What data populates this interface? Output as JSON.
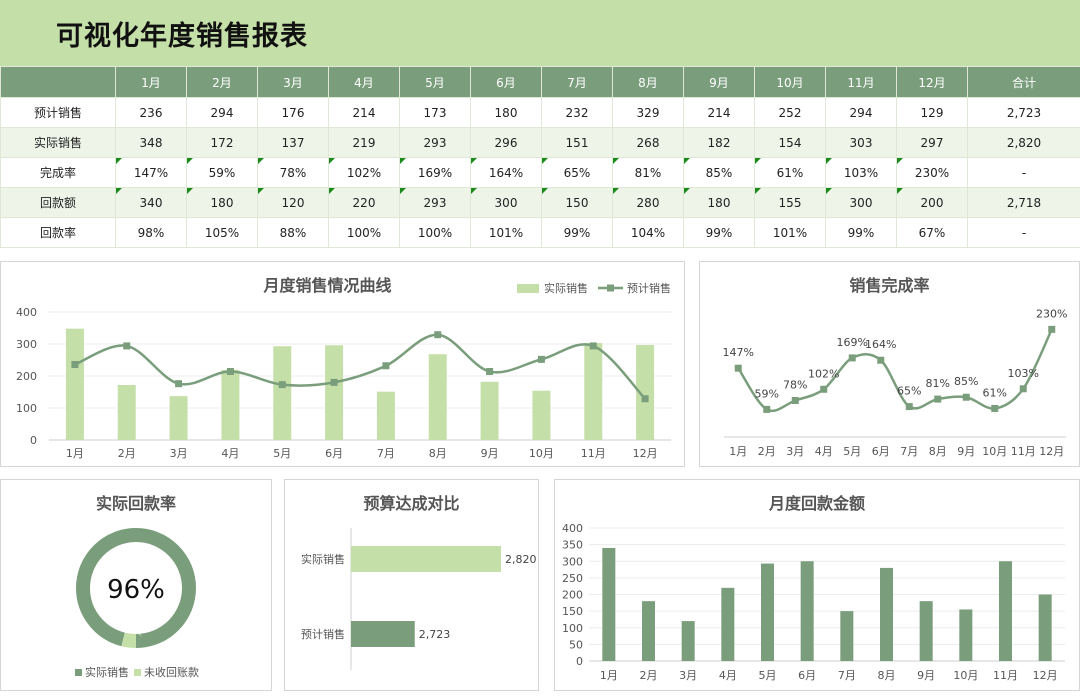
{
  "title": "可视化年度销售报表",
  "table": {
    "columns": [
      "",
      "1月",
      "2月",
      "3月",
      "4月",
      "5月",
      "6月",
      "7月",
      "8月",
      "9月",
      "10月",
      "11月",
      "12月",
      "合计"
    ],
    "rows": [
      {
        "label": "预计销售",
        "values": [
          "236",
          "294",
          "176",
          "214",
          "173",
          "180",
          "232",
          "329",
          "214",
          "252",
          "294",
          "129",
          "2,723"
        ],
        "flags": false
      },
      {
        "label": "实际销售",
        "values": [
          "348",
          "172",
          "137",
          "219",
          "293",
          "296",
          "151",
          "268",
          "182",
          "154",
          "303",
          "297",
          "2,820"
        ],
        "flags": false
      },
      {
        "label": "完成率",
        "values": [
          "147%",
          "59%",
          "78%",
          "102%",
          "169%",
          "164%",
          "65%",
          "81%",
          "85%",
          "61%",
          "103%",
          "230%",
          "-"
        ],
        "flags": true
      },
      {
        "label": "回款额",
        "values": [
          "340",
          "180",
          "120",
          "220",
          "293",
          "300",
          "150",
          "280",
          "180",
          "155",
          "300",
          "200",
          "2,718"
        ],
        "flags": true
      },
      {
        "label": "回款率",
        "values": [
          "98%",
          "105%",
          "88%",
          "100%",
          "100%",
          "101%",
          "99%",
          "104%",
          "99%",
          "101%",
          "99%",
          "67%",
          "-"
        ],
        "flags": false
      }
    ]
  },
  "colors": {
    "light_green": "#c5dfa8",
    "dark_green": "#7a9e7c",
    "flag": "#1a8a1a"
  },
  "chart_data": [
    {
      "type": "bar",
      "title": "月度销售情况曲线",
      "categories": [
        "1月",
        "2月",
        "3月",
        "4月",
        "5月",
        "6月",
        "7月",
        "8月",
        "9月",
        "10月",
        "11月",
        "12月"
      ],
      "series": [
        {
          "name": "实际销售",
          "type": "bar",
          "values": [
            348,
            172,
            137,
            219,
            293,
            296,
            151,
            268,
            182,
            154,
            303,
            297
          ]
        },
        {
          "name": "预计销售",
          "type": "line",
          "values": [
            236,
            294,
            176,
            214,
            173,
            180,
            232,
            329,
            214,
            252,
            294,
            129
          ]
        }
      ],
      "ylim": [
        0,
        400
      ],
      "yticks": [
        0,
        100,
        200,
        300,
        400
      ],
      "legend": "top-right"
    },
    {
      "type": "line",
      "title": "销售完成率",
      "categories": [
        "1月",
        "2月",
        "3月",
        "4月",
        "5月",
        "6月",
        "7月",
        "8月",
        "9月",
        "10月",
        "11月",
        "12月"
      ],
      "values": [
        147,
        59,
        78,
        102,
        169,
        164,
        65,
        81,
        85,
        61,
        103,
        230
      ],
      "labels": [
        "147%",
        "59%",
        "78%",
        "102%",
        "169%",
        "164%",
        "65%",
        "81%",
        "85%",
        "61%",
        "103%",
        "230%"
      ]
    },
    {
      "type": "pie",
      "title": "实际回款率",
      "center_label": "96%",
      "slices": [
        {
          "name": "实际销售",
          "value": 96
        },
        {
          "name": "未收回账款",
          "value": 4
        }
      ],
      "legend": "bottom"
    },
    {
      "type": "bar",
      "title": "预算达成对比",
      "orientation": "horizontal",
      "categories": [
        "实际销售",
        "预计销售"
      ],
      "values": [
        2820,
        2723
      ],
      "labels": [
        "2,820",
        "2,723"
      ]
    },
    {
      "type": "bar",
      "title": "月度回款金额",
      "categories": [
        "1月",
        "2月",
        "3月",
        "4月",
        "5月",
        "6月",
        "7月",
        "8月",
        "9月",
        "10月",
        "11月",
        "12月"
      ],
      "values": [
        340,
        180,
        120,
        220,
        293,
        300,
        150,
        280,
        180,
        155,
        300,
        200
      ],
      "ylim": [
        0,
        400
      ],
      "yticks": [
        0,
        50,
        100,
        150,
        200,
        250,
        300,
        350,
        400
      ]
    }
  ]
}
